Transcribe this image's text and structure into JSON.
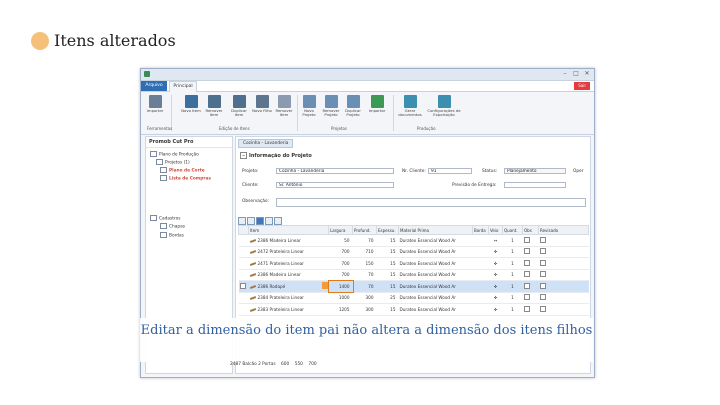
{
  "slide_title": "Itens alterados",
  "window": {
    "menu_arquivo": "Arquivo",
    "tab_principal": "Principal",
    "sair": "Sair"
  },
  "ribbon": {
    "buttons": [
      {
        "label": "Importar",
        "icon": "import-icon",
        "color": "#6a7f95"
      },
      {
        "label": "Novo Item",
        "icon": "new-item-icon",
        "color": "#3c6e9e"
      },
      {
        "label": "Remover Item",
        "icon": "remove-item-icon",
        "color": "#4f6f8f"
      },
      {
        "label": "Duplicar Item",
        "icon": "duplicate-item-icon",
        "color": "#4f6f8f"
      },
      {
        "label": "Novo Filho",
        "icon": "new-child-icon",
        "color": "#5e7590"
      },
      {
        "label": "Remover Item",
        "icon": "remove-child-icon",
        "color": "#8a9bb0"
      },
      {
        "label": "Novo Projeto",
        "icon": "new-project-icon",
        "color": "#6b8fb4"
      },
      {
        "label": "Remover Projeto",
        "icon": "remove-project-icon",
        "color": "#6b8fb4"
      },
      {
        "label": "Duplicar Projeto",
        "icon": "duplicate-project-icon",
        "color": "#6b8fb4"
      },
      {
        "label": "Importar",
        "icon": "checkbox-import-icon",
        "color": "#3d9a55"
      },
      {
        "label": "Gerar documentos",
        "icon": "generate-docs-icon",
        "color": "#3d8fb0"
      },
      {
        "label": "Configurações de Exportação",
        "icon": "export-config-icon",
        "color": "#3d8fb0"
      }
    ],
    "groups": [
      "Ferramentas",
      "Edição de Itens",
      "Projetos",
      "Produção"
    ]
  },
  "left_panel": {
    "title": "Promob Cut Pro",
    "tree": [
      {
        "label": "Plano de Produção",
        "icon": "folder-icon"
      },
      {
        "label": "Projetos (1)",
        "icon": "projects-icon"
      },
      {
        "label": "Plano de Corte",
        "icon": "cut-plan-icon",
        "color": "#d24a3a",
        "bold": true
      },
      {
        "label": "Lista de Compras",
        "icon": "shopping-list-icon",
        "color": "#d24a3a",
        "bold": true
      },
      {
        "label": "Cadastros",
        "icon": "registry-icon"
      },
      {
        "label": "Chapas",
        "icon": "sheets-icon"
      },
      {
        "label": "Bordas",
        "icon": "edges-icon"
      }
    ]
  },
  "document_tab": "Cozinha - Lavanderia",
  "project_info": {
    "section_title": "Informação do Projeto",
    "projeto_label": "Projeto:",
    "projeto_value": "Cozinha - Lavanderia",
    "nr_cliente_label": "Nr. Cliente:",
    "nr_cliente_value": "91",
    "status_label": "Status:",
    "status_value": "Planejamento",
    "open_label": "Oper",
    "cliente_label": "Cliente:",
    "cliente_value": "Sr. Antônio",
    "previsao_label": "Previsão de Entrega:",
    "observacao_label": "Observação:"
  },
  "grid": {
    "columns": [
      "",
      "Item",
      "Largura",
      "Profund.",
      "Espessu.",
      "Material Prima",
      "Borda",
      "Veio",
      "Quant.",
      "Obs",
      "Revisado"
    ],
    "rows": [
      {
        "id": "2386",
        "name": "Madeira Linear",
        "largura": "50",
        "profund": "70",
        "espessura": "15",
        "material": "Duratex Essencial Wood Ar",
        "veio": "↔",
        "quant": "1",
        "selected": false
      },
      {
        "id": "2472",
        "name": "Prateleira Linear",
        "largura": "700",
        "profund": "710",
        "espessura": "15",
        "material": "Duratex Essencial Wood Ar",
        "veio": "✣",
        "quant": "1",
        "selected": false
      },
      {
        "id": "2471",
        "name": "Prateleira Linear",
        "largura": "700",
        "profund": "150",
        "espessura": "15",
        "material": "Duratex Essencial Wood Ar",
        "veio": "✣",
        "quant": "1",
        "selected": false
      },
      {
        "id": "2386",
        "name": "Madeira Linear",
        "largura": "700",
        "profund": "70",
        "espessura": "15",
        "material": "Duratex Essencial Wood Ar",
        "veio": "✣",
        "quant": "1",
        "selected": false
      },
      {
        "id": "2386",
        "name": "Rodapé",
        "largura": "1400",
        "profund": "70",
        "espessura": "15",
        "material": "Duratex Essencial Wood Ar",
        "veio": "✣",
        "quant": "1",
        "selected": true
      },
      {
        "id": "2384",
        "name": "Prateleira Linear",
        "largura": "1000",
        "profund": "300",
        "espessura": "25",
        "material": "Duratex Essencial Wood Ar",
        "veio": "✣",
        "quant": "1",
        "selected": false
      },
      {
        "id": "2383",
        "name": "Prateleira Linear",
        "largura": "1205",
        "profund": "300",
        "espessura": "15",
        "material": "Duratex Essencial Wood Ar",
        "veio": "✣",
        "quant": "1",
        "selected": false
      }
    ],
    "bottom_row": {
      "id": "2487",
      "name": "Balcão 2 Portas",
      "largura": "600",
      "profund": "550",
      "espessura": "700"
    }
  },
  "caption": "Editar a dimensão do item pai não altera a dimensão dos itens filhos"
}
